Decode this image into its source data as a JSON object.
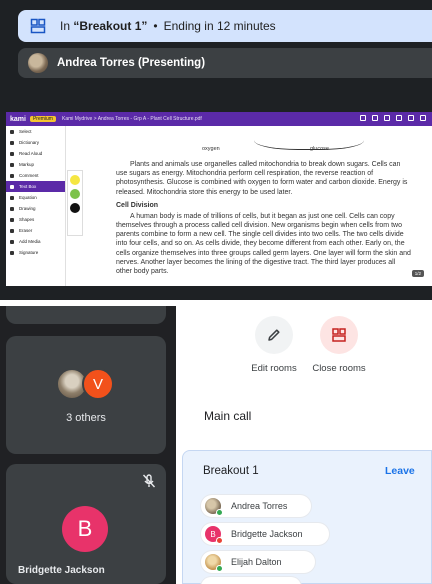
{
  "banner": {
    "prefix": "In",
    "room": "“Breakout 1”",
    "separator": "•",
    "status": "Ending in 12 minutes"
  },
  "presenter": {
    "name": "Andrea Torres (Presenting)"
  },
  "kami": {
    "logo": "kami",
    "premium_label": "Premium",
    "breadcrumb": "Kami Mydrive  >  Andrea Torres - Grp A - Plant Cell Structure.pdf",
    "tools": [
      "Select",
      "Dictionary",
      "Read Aloud",
      "Markup",
      "Comment",
      "Text Box",
      "Equation",
      "Drawing",
      "Shapes",
      "Eraser",
      "Add Media",
      "Signature"
    ],
    "active_tool": "Text Box",
    "swatch_colors": [
      "#f5e642",
      "#7cc24a",
      "#111111"
    ],
    "page_indicator": "1/2"
  },
  "doc": {
    "diagram_labels": [
      "oxygen",
      "glucose"
    ],
    "para1": "Plants and animals use organelles called mitochondria to break down sugars. Cells can use sugars as energy. Mitochondria perform cell respiration, the reverse reaction of photosynthesis. Glucose is combined with oxygen to form water and carbon dioxide. Energy is released. Mitochondria store this energy to be used later.",
    "heading": "Cell Division",
    "para2": "A human body is made of trillions of cells, but it began as just one cell. Cells can copy themselves through a process called cell division. New organisms begin when cells from two parents combine to form a new cell. The single cell divides into two cells. The two cells divide into four cells, and so on. As cells divide, they become different from each other. Early on, the cells organize themselves into three groups called germ layers. One layer will form the skin and nerves. Another layer becomes the lining of the digestive tract. The third layer produces all other body parts."
  },
  "tiles": {
    "others_initial": "V",
    "others_label": "3 others",
    "bridgette_initial": "B",
    "bridgette_name": "Bridgette Jackson"
  },
  "rooms": {
    "edit_label": "Edit rooms",
    "close_label": "Close rooms",
    "main_call": "Main call",
    "breakout_title": "Breakout 1",
    "leave_label": "Leave",
    "members": [
      {
        "name": "Andrea Torres",
        "initial": ""
      },
      {
        "name": "Bridgette Jackson",
        "initial": "B"
      },
      {
        "name": "Elijah Dalton",
        "initial": ""
      }
    ]
  },
  "colors": {
    "banner_bg": "#d3e3fd",
    "kami_purple": "#5b2aa8",
    "leave_blue": "#1a73e8",
    "bridgette_pink": "#e8336a",
    "others_orange": "#f2511b",
    "presence_green": "#34a853",
    "presence_red": "#ea4335"
  }
}
